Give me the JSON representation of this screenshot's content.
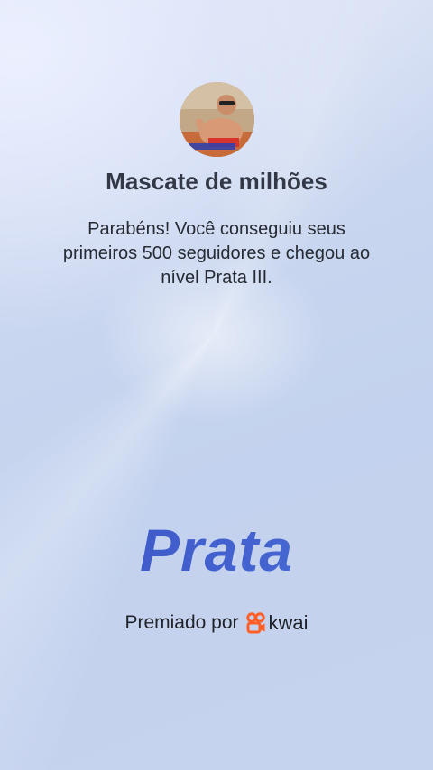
{
  "profile": {
    "name": "Mascate de milhões",
    "avatar_icon": "user-photo-avatar"
  },
  "message": "Parabéns! Você conseguiu seus primeiros 500 seguidores e chegou ao nível Prata III.",
  "level": {
    "name": "Prata",
    "color": "#3a5ccc"
  },
  "footer": {
    "awarded_by": "Premiado por",
    "brand_name": "kwai",
    "brand_icon": "kwai-logo-icon",
    "brand_color": "#ff5f27"
  }
}
